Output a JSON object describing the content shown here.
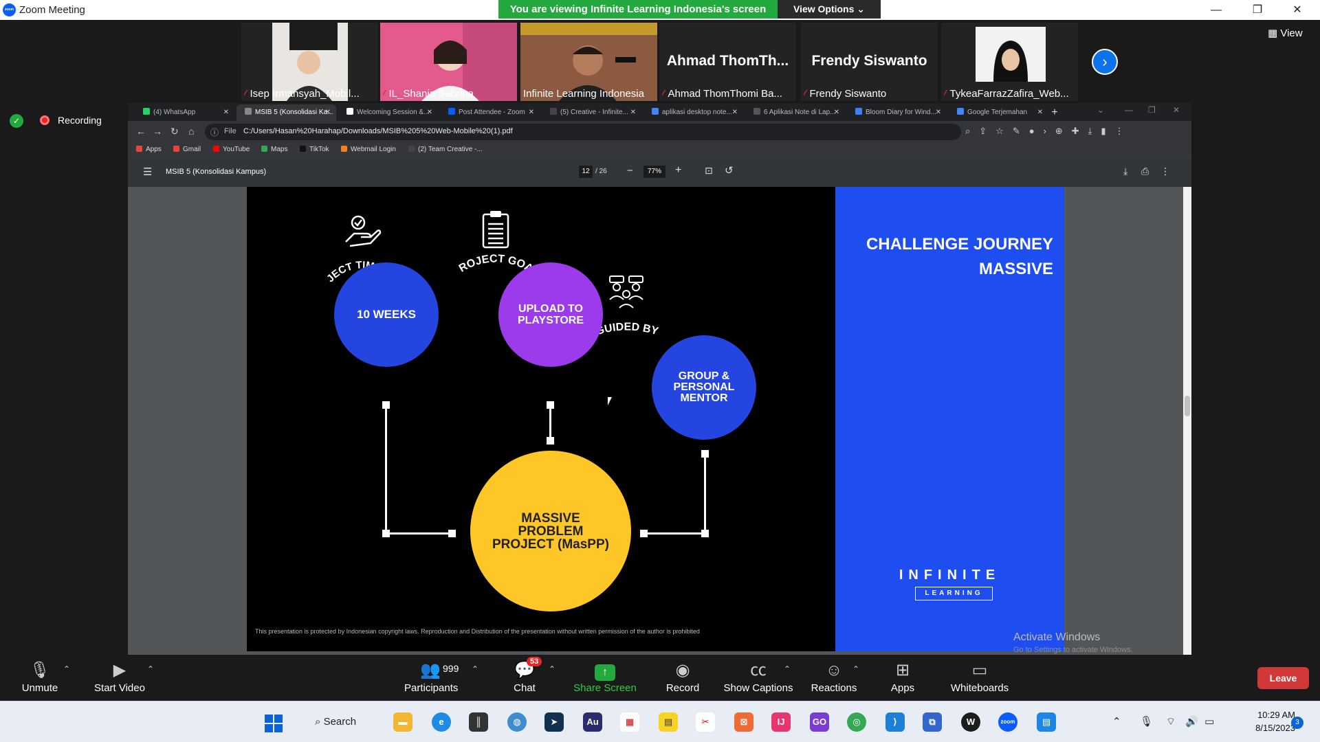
{
  "window": {
    "title": "Zoom Meeting",
    "share_banner": "You are viewing Infinite Learning Indonesia's screen",
    "view_options": "View Options ⌄",
    "view_label": "View",
    "recording": "Recording"
  },
  "participants": [
    {
      "name": "Isep Irmansyah_Mobil...",
      "video": true
    },
    {
      "name": "IL_Shania Sabrina",
      "video": true
    },
    {
      "name": "Infinite Learning Indonesia",
      "video": true,
      "active": true
    },
    {
      "name": "Ahmad ThomThomi Ba...",
      "display": "Ahmad  ThomTh...",
      "video": false
    },
    {
      "name": "Frendy Siswanto",
      "display": "Frendy Siswanto",
      "video": false
    },
    {
      "name": "TykeaFarrazZafira_Web...",
      "video": true
    }
  ],
  "browser": {
    "tabs": [
      {
        "label": "(4) WhatsApp",
        "color": "#25d366"
      },
      {
        "label": "MSIB 5 (Konsolidasi Ka...",
        "color": "#888888"
      },
      {
        "label": "Welcoming Session &...",
        "color": "#ffffff"
      },
      {
        "label": "Post Attendee - Zoom",
        "color": "#0b5cff"
      },
      {
        "label": "(5) Creative - Infinite...",
        "color": "#444444"
      },
      {
        "label": "aplikasi desktop note...",
        "color": "#4285f4"
      },
      {
        "label": "6 Aplikasi Note di Lap...",
        "color": "#555555"
      },
      {
        "label": "Bloom Diary for Wind...",
        "color": "#3b82f6"
      },
      {
        "label": "Google Terjemahan",
        "color": "#4285f4"
      }
    ],
    "file_label": "File",
    "url": "C:/Users/Hasan%20Harahap/Downloads/MSIB%205%20Web-Mobile%20(1).pdf",
    "bookmarks": [
      {
        "label": "Apps",
        "color": "#e8453c"
      },
      {
        "label": "Gmail",
        "color": "#ea4335"
      },
      {
        "label": "YouTube",
        "color": "#ff0000"
      },
      {
        "label": "Maps",
        "color": "#34a853"
      },
      {
        "label": "TikTok",
        "color": "#111111"
      },
      {
        "label": "Webmail Login",
        "color": "#f48120"
      },
      {
        "label": "(2) Team Creative -...",
        "color": "#444444"
      }
    ]
  },
  "pdf": {
    "doc_name": "MSIB 5 (Konsolidasi Kampus)",
    "page_current": "12",
    "page_total": "/ 26",
    "zoom": "77%"
  },
  "slide": {
    "title": "CHALLENGE JOURNEY MASSIVE",
    "label_time": "PROJECT TIME FRAME",
    "label_goal": "PROJECT GOAL",
    "label_guided": "GUIDED BY",
    "circle_time": "10 WEEKS",
    "circle_goal": "UPLOAD TO PLAYSTORE",
    "circle_guided": "GROUP & PERSONAL MENTOR",
    "circle_main": "MASSIVE PROBLEM PROJECT (MasPP)",
    "brand_main": "INFINITE",
    "brand_sub": "LEARNING",
    "footnote": "This presentation is protected by Indonesian copyright laws. Reproduction and Distribution of the presentation without written permission of the author is prohibited",
    "colors": {
      "blue": "#2545e0",
      "purple": "#9b3bec",
      "yellow": "#ffc628",
      "panel": "#1f4ef0"
    }
  },
  "activate_windows": {
    "title": "Activate Windows",
    "subtitle": "Go to Settings to activate Windows."
  },
  "toolbar": {
    "unmute": "Unmute",
    "start_video": "Start Video",
    "participants": "Participants",
    "participant_count": "999",
    "chat": "Chat",
    "chat_badge": "53",
    "share_screen": "Share Screen",
    "record": "Record",
    "show_captions": "Show Captions",
    "reactions": "Reactions",
    "apps": "Apps",
    "whiteboards": "Whiteboards",
    "leave": "Leave"
  },
  "taskbar": {
    "search": "Search",
    "time": "10:29 AM",
    "date": "8/15/2023",
    "notifications": "3"
  }
}
